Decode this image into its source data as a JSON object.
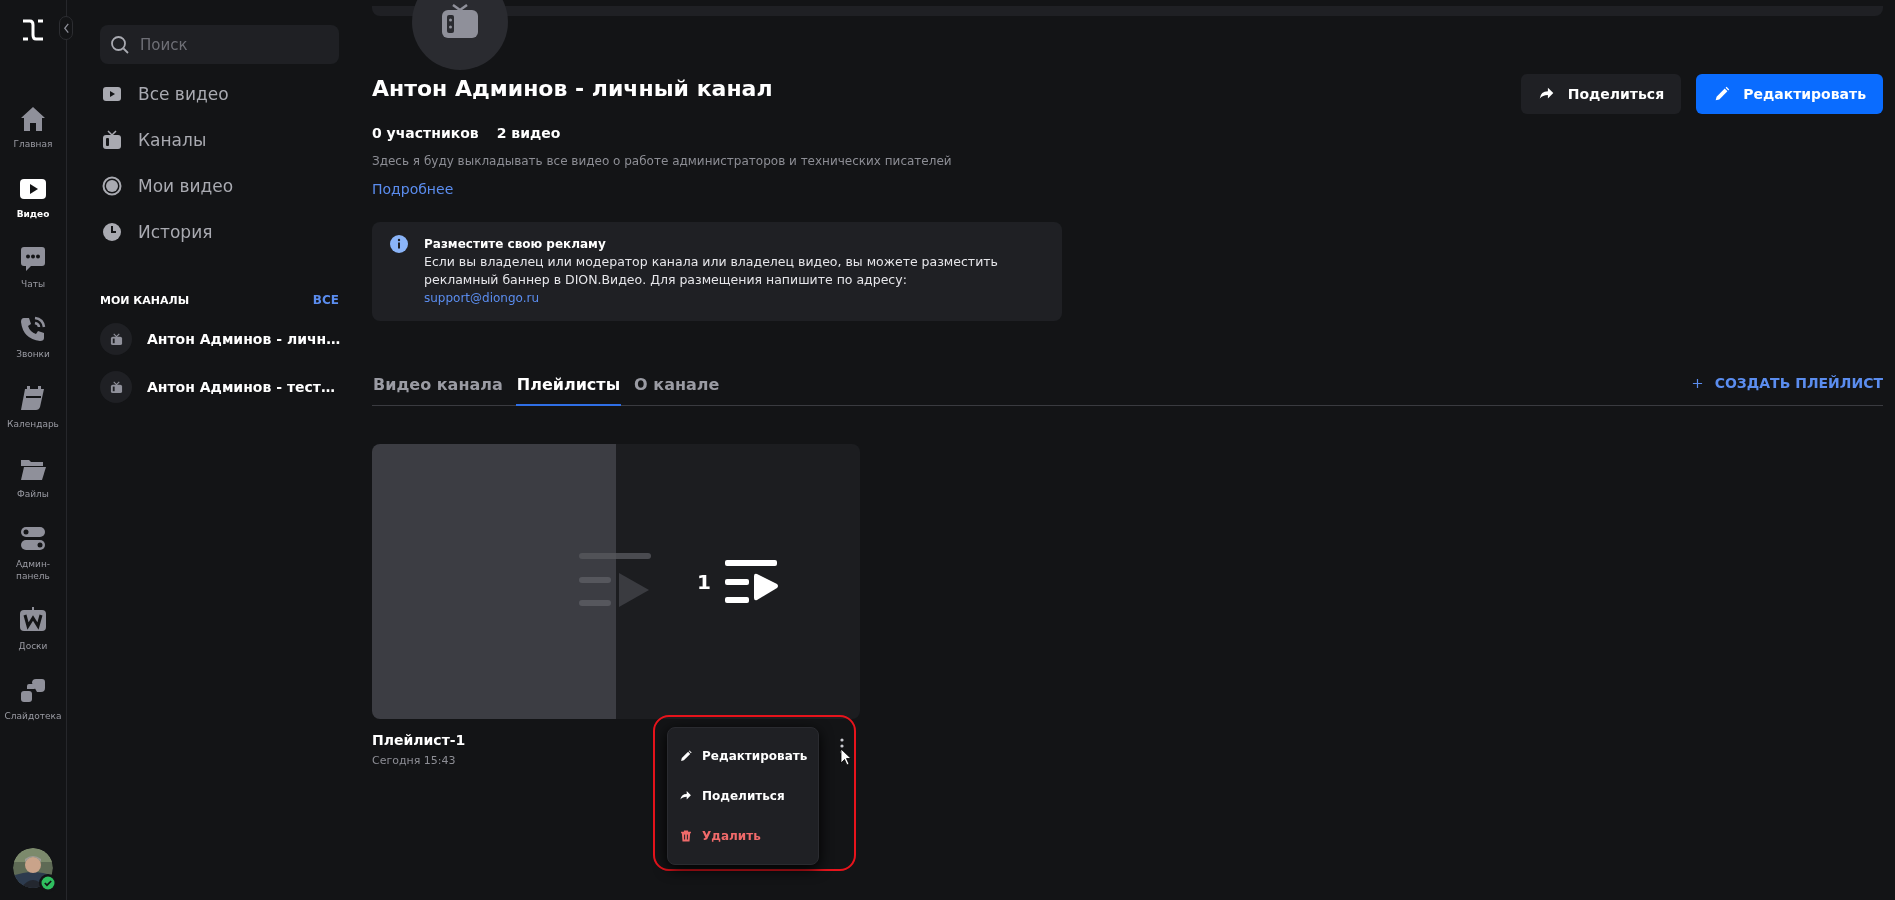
{
  "rail": {
    "items": [
      {
        "label": "Главная",
        "kind": "home",
        "selected": false
      },
      {
        "label": "Видео",
        "kind": "video",
        "selected": true
      },
      {
        "label": "Чаты",
        "kind": "chat",
        "selected": false
      },
      {
        "label": "Звонки",
        "kind": "phone",
        "selected": false
      },
      {
        "label": "Календарь",
        "kind": "calendar",
        "selected": false
      },
      {
        "label": "Файлы",
        "kind": "folder",
        "selected": false
      },
      {
        "label": "Админ-панель",
        "kind": "toggles",
        "selected": false
      },
      {
        "label": "Доски",
        "kind": "board",
        "selected": false
      },
      {
        "label": "Слайдотека",
        "kind": "slides",
        "selected": false
      }
    ],
    "user": {
      "online": true
    }
  },
  "sidebar": {
    "search": {
      "placeholder": "Поиск"
    },
    "items": [
      {
        "label": "Все видео",
        "kind": "play"
      },
      {
        "label": "Каналы",
        "kind": "tv"
      },
      {
        "label": "Мои видео",
        "kind": "record"
      },
      {
        "label": "История",
        "kind": "clock"
      }
    ],
    "section": {
      "title": "МОИ КАНАЛЫ",
      "action": "ВСЕ"
    },
    "channels": [
      {
        "name": "Антон Админов - личн…"
      },
      {
        "name": "Антон Админов - тест…"
      }
    ]
  },
  "channel": {
    "title": "Антон Админов - личный канал",
    "members": "0 участников",
    "videos": "2 видео",
    "description": "Здесь я буду выкладывать все видео о работе администраторов и технических писателей",
    "more": "Подробнее",
    "actions": [
      {
        "label": "Поделиться",
        "kind": "share"
      },
      {
        "label": "Редактировать",
        "kind": "edit"
      }
    ]
  },
  "notice": {
    "title": "Разместите свою рекламу",
    "text": "Если вы владелец или модератор канала или владелец видео, вы можете разместить рекламный баннер в DION.Видео. Для размещения напишите по адресу:",
    "email": "support@diongo.ru"
  },
  "tabs": [
    {
      "label": "Видео канала",
      "selected": false
    },
    {
      "label": "Плейлисты",
      "selected": true
    },
    {
      "label": "О канале",
      "selected": false
    }
  ],
  "create_button": "СОЗДАТЬ ПЛЕЙЛИСТ",
  "playlists": [
    {
      "title": "Плейлист-1",
      "date": "Сегодня 15:43",
      "count": "1"
    }
  ],
  "menu": {
    "highlighted": true,
    "items": [
      {
        "label": "Редактировать",
        "kind": "edit"
      },
      {
        "label": "Поделиться",
        "kind": "share"
      },
      {
        "label": "Удалить",
        "kind": "delete"
      }
    ]
  }
}
